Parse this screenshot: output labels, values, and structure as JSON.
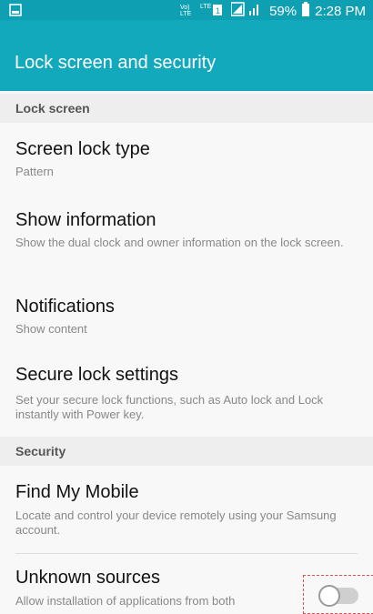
{
  "status_bar": {
    "battery": "59%",
    "time": "2:28 PM",
    "icons": [
      "sim-icon",
      "volte-icon",
      "lte-icon",
      "signal-icon",
      "battery-icon"
    ]
  },
  "app_bar": {
    "title": "Lock screen and security"
  },
  "sections": [
    {
      "header": "Lock screen"
    },
    {
      "header": "Security"
    }
  ],
  "items": {
    "screen_lock_type": {
      "title": "Screen lock type",
      "subtitle": "Pattern"
    },
    "show_information": {
      "title": "Show information",
      "subtitle": "Show the dual clock and owner information on the lock screen."
    },
    "notifications": {
      "title": "Notifications",
      "subtitle": "Show content"
    },
    "secure_lock_settings": {
      "title": "Secure lock settings",
      "subtitle": "Set your secure lock functions, such as Auto lock and Lock instantly with Power key."
    },
    "find_my_mobile": {
      "title": "Find My Mobile",
      "subtitle": "Locate and control your device remotely using your Samsung account."
    },
    "unknown_sources": {
      "title": "Unknown sources",
      "subtitle": "Allow installation of applications from both",
      "toggle_state": "off"
    }
  },
  "colors": {
    "accent": "#12a9bd",
    "status_bar": "#0f9fb3"
  }
}
